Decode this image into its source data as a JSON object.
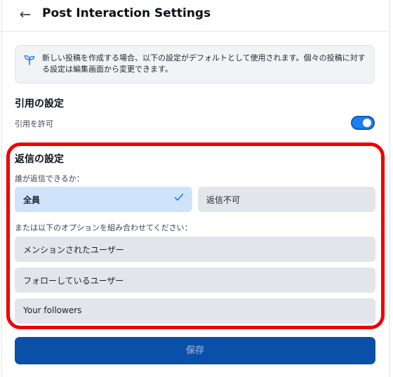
{
  "header": {
    "back_icon": "arrow-left-icon",
    "back_glyph": "←",
    "title": "Post Interaction Settings"
  },
  "info": {
    "icon": "sprout-icon",
    "text": "新しい投稿を作成する場合、以下の設定がデフォルトとして使用されます。個々の投稿に対する設定は編集画面から変更できます。"
  },
  "quote": {
    "title": "引用の設定",
    "allow_label": "引用を許可",
    "allow_enabled": true
  },
  "reply": {
    "title": "返信の設定",
    "who_label": "誰が返信できるか：",
    "options": [
      {
        "label": "全員",
        "selected": true
      },
      {
        "label": "返信不可",
        "selected": false
      }
    ],
    "combine_label": "または以下のオプションを組み合わせてください：",
    "combo_options": [
      {
        "label": "メンションされたユーザー"
      },
      {
        "label": "フォローしているユーザー"
      },
      {
        "label": "Your followers"
      }
    ]
  },
  "save": {
    "label": "保存"
  },
  "colors": {
    "accent": "#1d7ef0",
    "save_button": "#0a4fa8",
    "highlight": "#f00000",
    "selected_option": "#cfe3fb"
  }
}
